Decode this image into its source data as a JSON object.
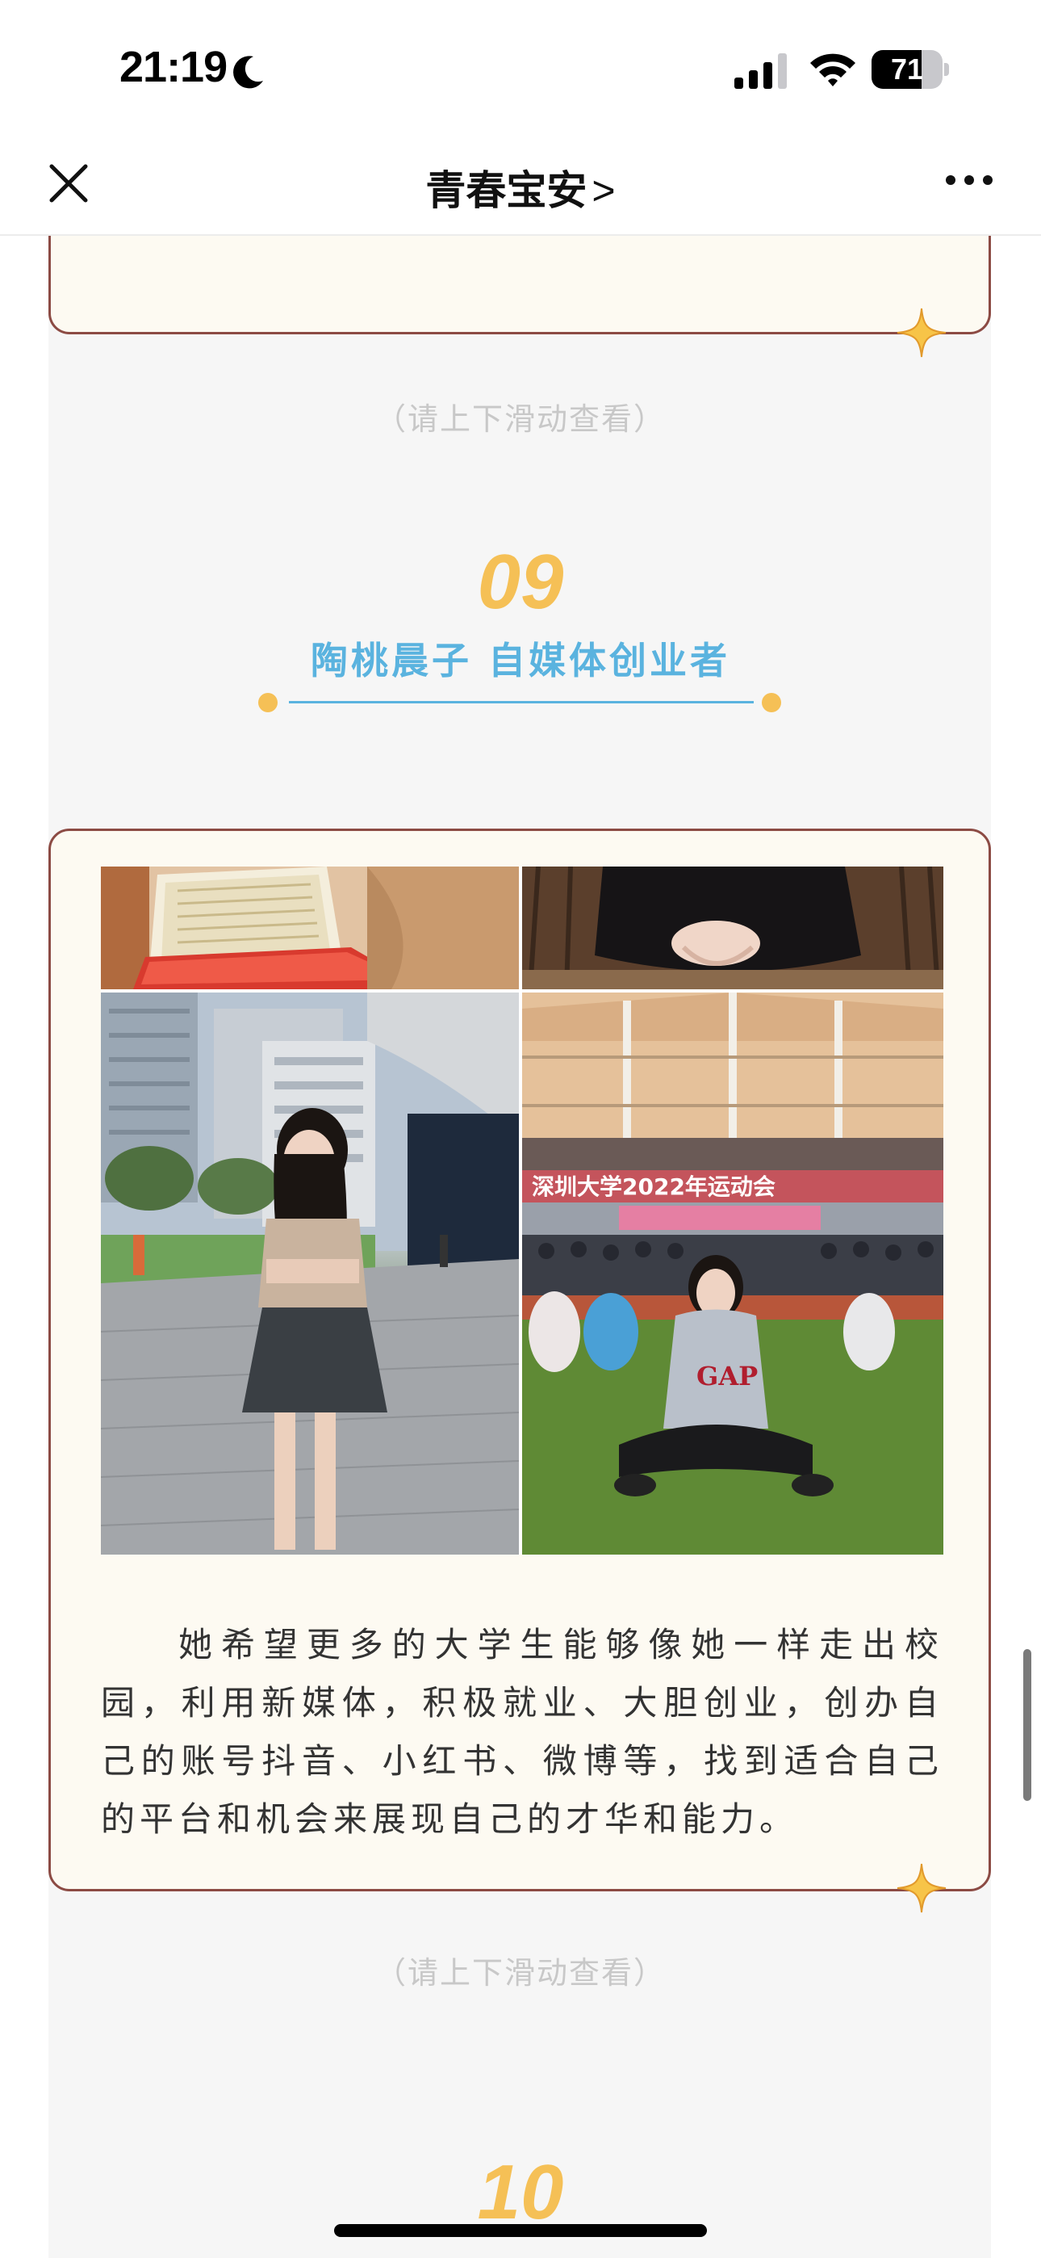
{
  "status_bar": {
    "time": "21:19",
    "battery_percent": "71",
    "battery_level": 0.71,
    "icons": [
      "moon-icon",
      "signal-icon",
      "wifi-icon",
      "battery-icon"
    ]
  },
  "nav": {
    "title": "青春宝安",
    "title_chevron": ">",
    "icons": [
      "close-icon",
      "more-icon"
    ]
  },
  "article": {
    "scroll_hint_top": "（请上下滑动查看）",
    "section": {
      "number": "09",
      "title": "陶桃晨子 自媒体创业者"
    },
    "photo_collage": {
      "banner_text": "深圳大学2022年运动会",
      "shirt_text": "GAP"
    },
    "body_text": "她希望更多的大学生能够像她一样走出校园，利用新媒体，积极就业、大胆创业，创办自己的账号抖音、小红书、微博等，找到适合自己的平台和机会来展现自己的才华和能力。",
    "scroll_hint_bottom": "（请上下滑动查看）",
    "next_section_number": "10"
  },
  "colors": {
    "accent_gold": "#f5c056",
    "title_blue": "#5ab3df",
    "card_border": "#8c4b44",
    "card_bg": "#fdfaf2",
    "page_bg": "#f6f6f6"
  }
}
